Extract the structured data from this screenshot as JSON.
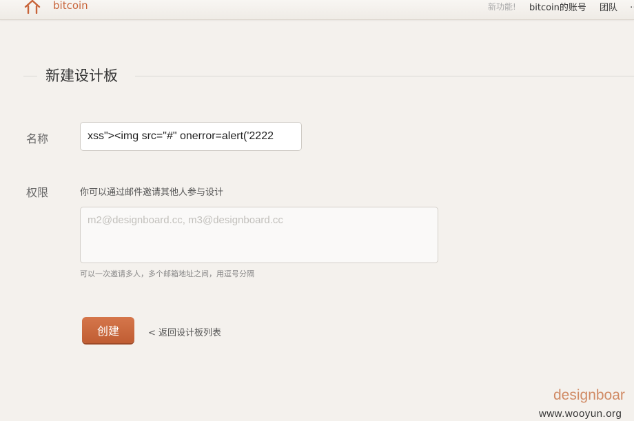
{
  "topbar": {
    "brand": "bitcoin",
    "new_feature": "新功能!",
    "account": "bitcoin的账号",
    "team": "团队",
    "more": "…"
  },
  "page": {
    "section_title": "新建设计板"
  },
  "form": {
    "name_label": "名称",
    "name_value": "xss\"><img src=\"#\" onerror=alert('2222",
    "permission_label": "权限",
    "permission_desc": "你可以通过邮件邀请其他人参与设计",
    "emails_placeholder": "m2@designboard.cc, m3@designboard.cc",
    "emails_value": "",
    "emails_hint": "可以一次邀请多人，多个邮箱地址之间，用逗号分隔",
    "create_label": "创建",
    "back_label": "< 返回设计板列表"
  },
  "footer": {
    "logo": "designboar",
    "watermark": "www.wooyun.org"
  },
  "colors": {
    "accent": "#c8643a",
    "background": "#f4f1ed",
    "button": "#c9683c"
  },
  "icons": {
    "home": "home-icon"
  }
}
